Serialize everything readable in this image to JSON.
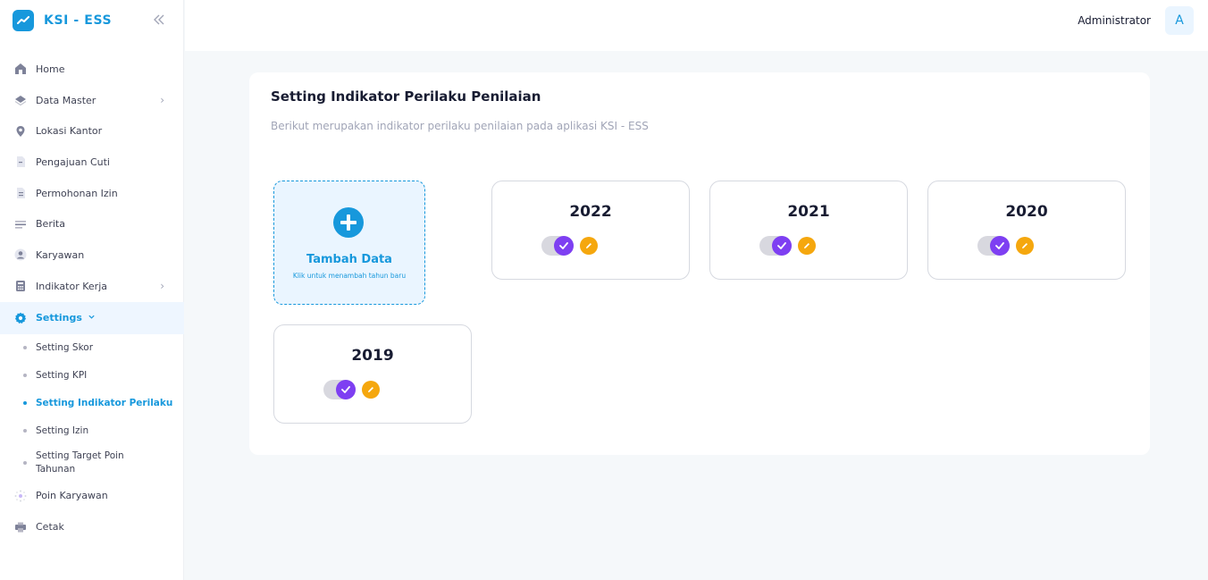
{
  "brand": {
    "name": "KSI - ESS",
    "color": "#1798dc"
  },
  "sidebar": {
    "items": [
      {
        "label": "Home",
        "icon": "home-icon"
      },
      {
        "label": "Data Master",
        "icon": "layers-icon",
        "has_arrow": true
      },
      {
        "label": "Lokasi Kantor",
        "icon": "location-pin-icon"
      },
      {
        "label": "Pengajuan Cuti",
        "icon": "document-icon"
      },
      {
        "label": "Permohonan Izin",
        "icon": "document-text-icon"
      },
      {
        "label": "Berita",
        "icon": "news-lines-icon"
      },
      {
        "label": "Karyawan",
        "icon": "user-avatar-icon"
      },
      {
        "label": "Indikator Kerja",
        "icon": "calculator-icon",
        "has_arrow": true
      },
      {
        "label": "Settings",
        "icon": "gear-icon",
        "active": true,
        "expanded": true
      }
    ],
    "submenu": [
      {
        "label": "Setting Skor"
      },
      {
        "label": "Setting KPI"
      },
      {
        "label": "Setting Indikator Perilaku",
        "active": true
      },
      {
        "label": "Setting Izin"
      },
      {
        "label": "Setting Target Poin Tahunan"
      }
    ],
    "items_after": [
      {
        "label": "Poin Karyawan",
        "icon": "sparkle-icon"
      },
      {
        "label": "Cetak",
        "icon": "printer-icon"
      }
    ]
  },
  "header": {
    "user_name": "Administrator",
    "avatar_initial": "A"
  },
  "page": {
    "title": "Setting Indikator Perilaku Penilaian",
    "subtitle": "Berikut merupakan indikator perilaku penilaian pada aplikasi KSI - ESS",
    "add_card": {
      "label": "Tambah Data",
      "hint": "Klik untuk menambah tahun baru"
    },
    "years": [
      {
        "year": "2022",
        "active": true
      },
      {
        "year": "2021",
        "active": true
      },
      {
        "year": "2020",
        "active": true
      },
      {
        "year": "2019",
        "active": true
      }
    ]
  },
  "colors": {
    "accent": "#1798dc",
    "toggle_on": "#7e3ff2",
    "edit": "#f5a70e",
    "background": "#f5f8fa"
  }
}
